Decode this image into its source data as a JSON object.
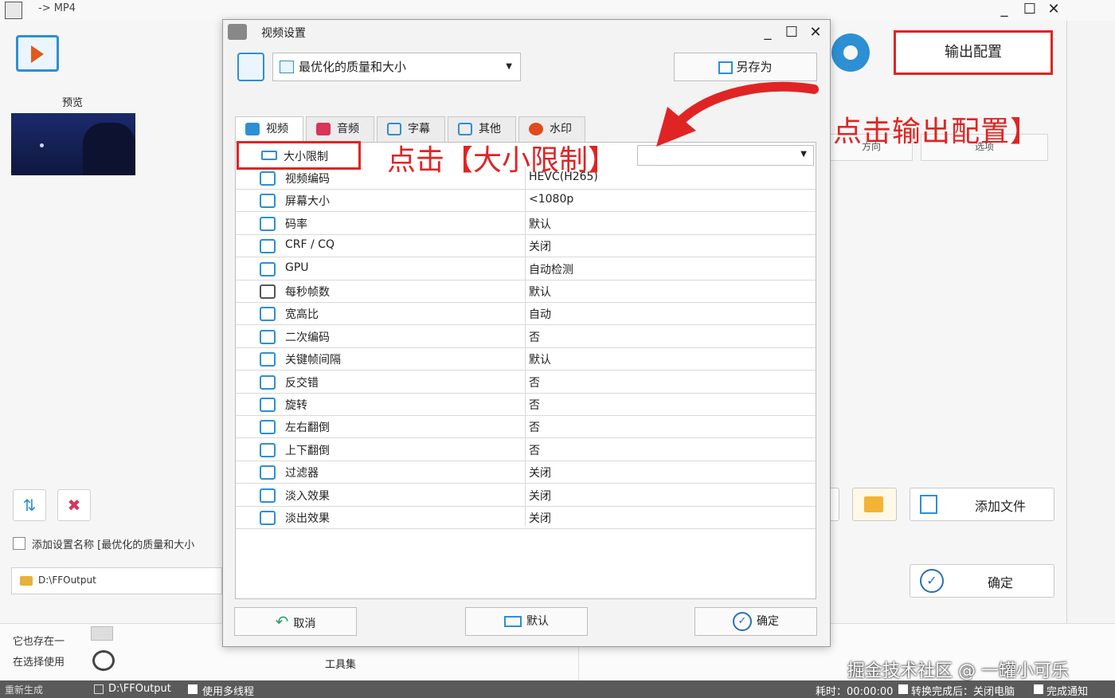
{
  "main": {
    "title": "-> MP4",
    "preview_label": "预览",
    "preset_note": "添加设置名称 [最优化的质量和大小",
    "output_path": "D:\\FFOutput",
    "output_config_button": "输出配置",
    "add_file_button": "添加文件",
    "confirm_button": "确定",
    "ghost_btn_left": "方向",
    "ghost_btn_right": "选项",
    "lower_line1": "它也存在一",
    "lower_line2": "在选择使用",
    "toolbar_label": "工具集",
    "status": {
      "regen": "重新生成",
      "path": "D:\\FFOutput",
      "multithread": "使用多线程",
      "elapsed": "耗时：00:00:00",
      "after_convert": "转换完成后：关闭电脑",
      "notify": "完成通知"
    }
  },
  "dialog": {
    "title": "视频设置",
    "preset": "最优化的质量和大小",
    "save_as": "另存为",
    "tabs": [
      {
        "label": "视频",
        "color": "#2d8fd4"
      },
      {
        "label": "音频",
        "color": "#d9345a"
      },
      {
        "label": "字幕",
        "color": "#2d8fd4"
      },
      {
        "label": "其他",
        "color": "#2d8fd4"
      },
      {
        "label": "水印",
        "color": "#e04a1c"
      }
    ],
    "selected_row": "大小限制",
    "rows": [
      {
        "name": "视频编码",
        "value": "HEVC(H265)"
      },
      {
        "name": "屏幕大小",
        "value": "<1080p"
      },
      {
        "name": "码率",
        "value": "默认"
      },
      {
        "name": "CRF / CQ",
        "value": "关闭"
      },
      {
        "name": "GPU",
        "value": "自动检测"
      },
      {
        "name": "每秒帧数",
        "value": "默认"
      },
      {
        "name": "宽高比",
        "value": "自动"
      },
      {
        "name": "二次编码",
        "value": "否"
      },
      {
        "name": "关键帧间隔",
        "value": "默认"
      },
      {
        "name": "反交错",
        "value": "否"
      },
      {
        "name": "旋转",
        "value": "否"
      },
      {
        "name": "左右翻倒",
        "value": "否"
      },
      {
        "name": "上下翻倒",
        "value": "否"
      },
      {
        "name": "过滤器",
        "value": "关闭"
      },
      {
        "name": "淡入效果",
        "value": "关闭"
      },
      {
        "name": "淡出效果",
        "value": "关闭"
      }
    ],
    "cancel": "取消",
    "default": "默认",
    "ok": "确定"
  },
  "annotations": {
    "click_size_limit": "点击【大小限制】",
    "click_output_config": "点击输出配置】",
    "color": "#e02424"
  },
  "watermark": "掘金技术社区 @ 一罐小可乐"
}
